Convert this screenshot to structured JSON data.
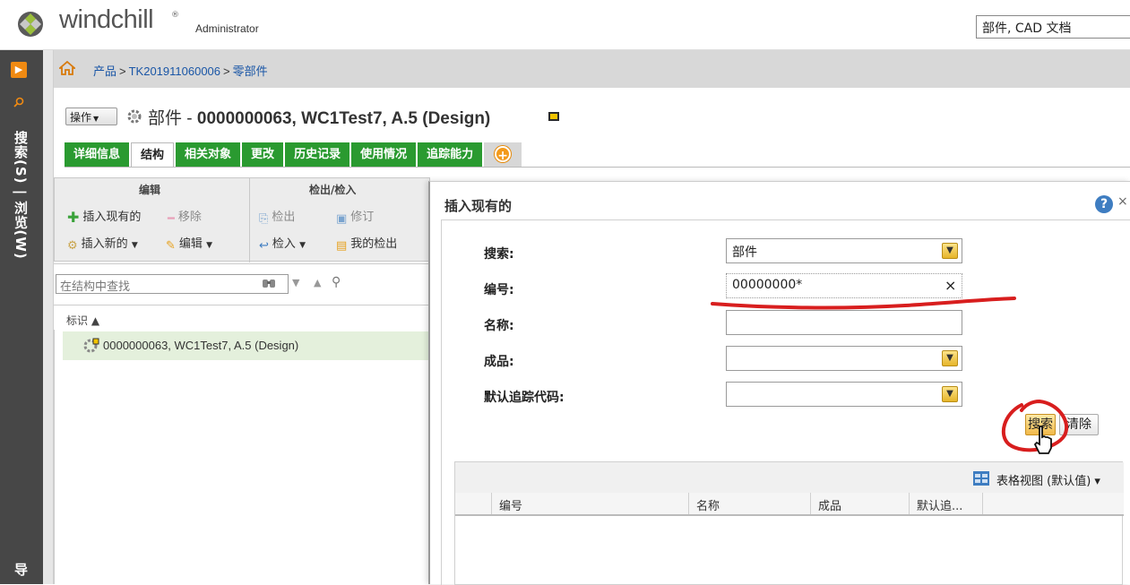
{
  "app": {
    "logo_text": "windchill",
    "logo_reg": "®",
    "user": "Administrator",
    "global_search_value": "部件, CAD 文档"
  },
  "left_nav": {
    "toggle_glyph": "▶",
    "vertical_label": "搜索(S) | 浏览(W)",
    "bottom_label": "导"
  },
  "breadcrumb": {
    "items": [
      "产品",
      "TK201911060006",
      "零部件"
    ],
    "separator": ">"
  },
  "header": {
    "actions_label": "操作",
    "title_prefix": "部件 - ",
    "title": "0000000063, WC1Test7, A.5 (Design)"
  },
  "tabs": [
    {
      "label": "详细信息"
    },
    {
      "label": "结构"
    },
    {
      "label": "相关对象"
    },
    {
      "label": "更改"
    },
    {
      "label": "历史记录"
    },
    {
      "label": "使用情况"
    },
    {
      "label": "追踪能力"
    }
  ],
  "toolbar": {
    "edit_group": "编辑",
    "checkout_group": "检出/检入",
    "insert_existing": "插入现有的",
    "remove": "移除",
    "insert_new": "插入新的",
    "edit": "编辑",
    "checkout": "检出",
    "revise": "修订",
    "checkin": "检入",
    "my_checkouts": "我的检出"
  },
  "structure": {
    "find_placeholder": "在结构中查找",
    "column_label": "标识 ▲",
    "root_item": "0000000063, WC1Test7, A.5 (Design)"
  },
  "dialog": {
    "title": "插入现有的",
    "help": "?",
    "close": "×",
    "fields": {
      "search_label": "搜索:",
      "search_value": "部件",
      "number_label": "编号:",
      "number_value": "00000000*",
      "name_label": "名称:",
      "name_value": "",
      "product_label": "成品:",
      "product_value": "",
      "trace_label": "默认追踪代码:",
      "trace_value": ""
    },
    "search_button": "搜索",
    "clear_button": "清除",
    "clear_field_glyph": "×",
    "view_label": "表格视图 (默认值) ▾",
    "columns": [
      "编号",
      "名称",
      "成品",
      "默认追..."
    ]
  },
  "colors": {
    "tab_green": "#2a9a30",
    "accent_orange": "#f08a12",
    "annotation_red": "#d81e1e",
    "link_blue": "#1a56a6"
  }
}
